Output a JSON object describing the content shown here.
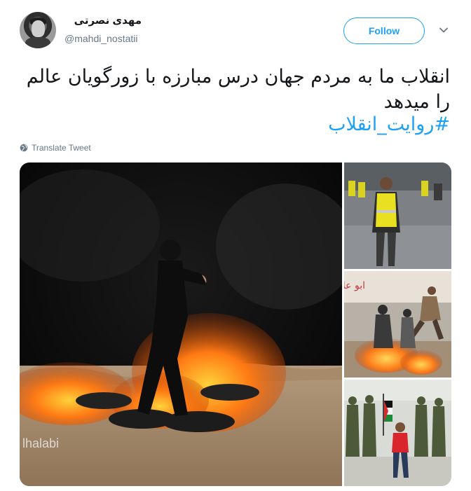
{
  "user": {
    "display_name": "مهدی نصرتی",
    "handle": "@mahdi_nostatii"
  },
  "actions": {
    "follow_label": "Follow",
    "menu_icon": "chevron-down-icon"
  },
  "tweet": {
    "text": "انقلاب ما به مردم جهان درس مبارزه با زورگویان عالم را میدهد",
    "hashtag": "#روایت_انقلاب",
    "translate_label": "Translate Tweet",
    "translate_icon": "globe-icon"
  },
  "media": {
    "watermark": "lhalabi"
  },
  "colors": {
    "accent": "#1da1f2",
    "text": "#14171a",
    "muted": "#657786"
  }
}
